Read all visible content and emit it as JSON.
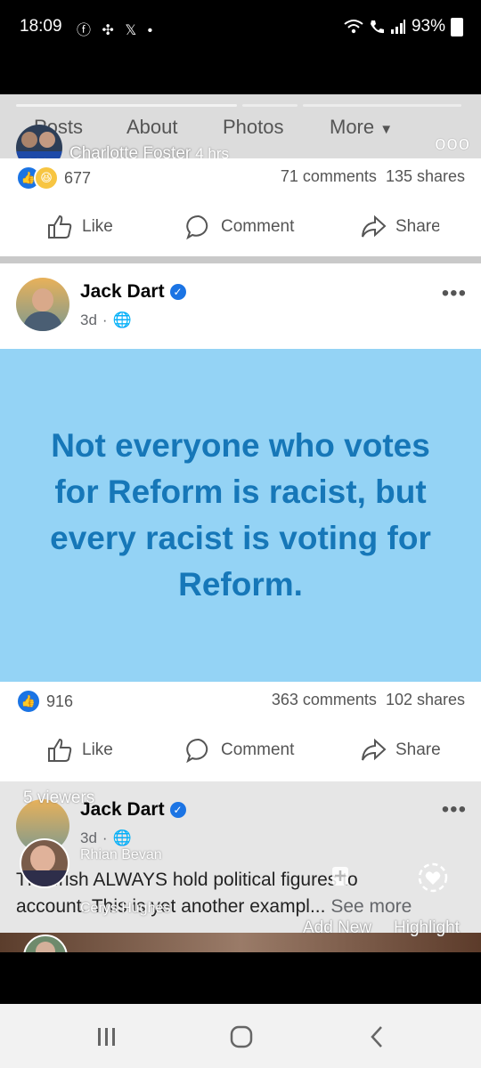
{
  "status_bar": {
    "time": "18:09",
    "icons_left": [
      "facebook-icon",
      "pinwheel-icon",
      "x-icon",
      "dot-icon"
    ],
    "battery": "93%"
  },
  "story": {
    "tabs": [
      "Posts",
      "About",
      "Photos",
      "More"
    ],
    "user_name": "Charlotte Foster",
    "time_ago": "4 hrs",
    "viewers_label": "5 viewers",
    "viewer_names": [
      "Rhian Bevan",
      "Cerys Hughes"
    ],
    "add_new_label": "Add New",
    "highlight_label": "Highlight"
  },
  "post1": {
    "reaction_count": "677",
    "comments": "71 comments",
    "shares": "135 shares",
    "like": "Like",
    "comment": "Comment",
    "share": "Share"
  },
  "post2": {
    "author": "Jack Dart",
    "time": "3d",
    "text": "Not everyone who votes for Reform is racist, but every racist is voting for Reform.",
    "reaction_count": "916",
    "comments": "363 comments",
    "shares": "102 shares",
    "like": "Like",
    "comment": "Comment",
    "share": "Share"
  },
  "post3": {
    "author": "Jack Dart",
    "time": "3d",
    "text_line1": "The Irish ALWAYS hold political figures to",
    "text_line2": "account. This is yet another exampl...",
    "see_more": "See more"
  },
  "colors": {
    "facebook_blue": "#1b74e4",
    "banner_bg": "#94d3f5",
    "banner_text": "#1677b8"
  }
}
